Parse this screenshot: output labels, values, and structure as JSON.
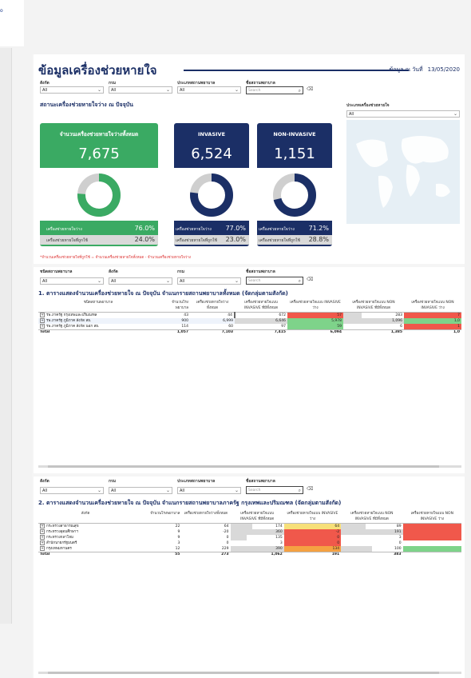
{
  "nav": {
    "fragment": "o"
  },
  "header": {
    "title": "ข้อมูลเครื่องช่วยหายใจ",
    "date_label": "ข้อมูล ณ วันที่",
    "date_value": "13/05/2020"
  },
  "filters_top": {
    "affiliation_label": "สังกัด",
    "ministry_label": "กรม",
    "hosptype_label": "ประเภทสถานพยาบาล",
    "hospname_label": "ชื่อสถานพยาบาล",
    "all": "All",
    "search_placeholder": "Search"
  },
  "status_section": {
    "title": "สถานะเครื่องช่วยหายใจว่าง ณ ปัจจุบัน",
    "machine_type_label": "ประเภทเครื่องช่วยหายใจ",
    "note": "*จำนวนเครื่องช่วยหายใจที่ถูกใช้ = จำนวนเครื่องช่วยหายใจทั้งหมด - จำนวนเครื่องช่วยหายใจว่าง"
  },
  "kpis": [
    {
      "title": "จำนวนเครื่องช่วยหายใจว่างทั้งหมด",
      "value": "7,675",
      "free_label": "เครื่องช่วยหายใจว่าง",
      "free_pct": "76.0%",
      "used_label": "เครื่องช่วยหายใจที่ถูกใช้",
      "used_pct": "24.0%",
      "free_fraction": 0.76,
      "color": "#3aaa63"
    },
    {
      "title": "INVASIVE",
      "value": "6,524",
      "free_label": "เครื่องช่วยหายใจว่าง",
      "free_pct": "77.0%",
      "used_label": "เครื่องช่วยหายใจที่ถูกใช้",
      "used_pct": "23.0%",
      "free_fraction": 0.77,
      "color": "#1b2f66"
    },
    {
      "title": "NON-INVASIVE",
      "value": "1,151",
      "free_label": "เครื่องช่วยหายใจว่าง",
      "free_pct": "71.2%",
      "used_label": "เครื่องช่วยหายใจที่ถูกใช้",
      "used_pct": "28.8%",
      "free_fraction": 0.712,
      "color": "#1b2f66"
    }
  ],
  "table1": {
    "title": "1. ตารางแสดงจำนวนเครื่องช่วยหายใจ ณ ปัจจุบัน จำแนกรายสถานพยาบาลทั้งหมด (จัดกลุ่มตามสังกัด)",
    "filter_labels": {
      "hosptype": "ชนิดสถานพยาบาล",
      "affiliation": "สังกัด",
      "ministry": "กรม",
      "hospname": "ชื่อสถานพยาบาล"
    },
    "headers": [
      "ชนิดสถานพยาบาล",
      "จำนวนโรงพยาบาล",
      "เครื่องช่วยหายใจว่างทั้งหมด",
      "เครื่องช่วยหายใจแบบ INVASIVE ที่มีทั้งหมด",
      "เครื่องช่วยหายใจแบบ INVASIVE ว่าง",
      "เครื่องช่วยหายใจแบบ NON INVASIVE ที่มีทั้งหมด",
      "เครื่องช่วยหายใจแบบ NON INVASIVE ว่าง"
    ],
    "rows": [
      {
        "name": "รพ.ภาครัฐ กรุงเทพและปริมณฑล",
        "c1": "43",
        "c2": "44",
        "c3": "672",
        "c4": "57",
        "c5": "283",
        "c6": "7"
      },
      {
        "name": "รพ.ภาครัฐ ภูมิภาค สังกัด สธ.",
        "c1": "900",
        "c2": "6,999",
        "c3": "6,646",
        "c4": "5,978",
        "c5": "1,096",
        "c6": "1,0"
      },
      {
        "name": "รพ.ภาครัฐ ภูมิภาค สังกัด นอก สธ.",
        "c1": "114",
        "c2": "60",
        "c3": "97",
        "c4": "59",
        "c5": "6",
        "c6": "1"
      }
    ],
    "total": {
      "name": "Total",
      "c1": "1,057",
      "c2": "7,103",
      "c3": "7,415",
      "c4": "6,094",
      "c5": "1,385",
      "c6": "1,0"
    }
  },
  "table2": {
    "title": "2. ตารางแสดงจำนวนเครื่องช่วยหายใจ ณ ปัจจุบัน จำแนกรายสถานพยาบาลภาครัฐ กรุงเทพและปริมณฑล (จัดกลุ่มตามสังกัด)",
    "filter_labels": {
      "affiliation": "สังกัด",
      "ministry": "กรม",
      "hosptype": "ประเภทสถานพยาบาล",
      "hospname": "ชื่อสถานพยาบาล"
    },
    "headers": [
      "สังกัด",
      "จำนวนโรงพยาบาล",
      "เครื่องช่วยหายใจว่างทั้งหมด",
      "เครื่องช่วยหายใจแบบ INVASIVE ที่มีทั้งหมด",
      "เครื่องช่วยหายใจแบบ INVASIVE ว่าง",
      "เครื่องช่วยหายใจแบบ NON INVASIVE ที่มีทั้งหมด",
      "เครื่องช่วยหายใจแบบ NON INVASIVE ว่าง"
    ],
    "rows": [
      {
        "name": "กระทรวงสาธารณสุข",
        "c1": "22",
        "c2": "64",
        "c3": "174",
        "c4": "64",
        "c5": "89",
        "c6": ""
      },
      {
        "name": "กระทรวงอุดมศึกษาฯ",
        "c1": "9",
        "c2": "-20",
        "c3": "360",
        "c4": "-2",
        "c5": "191",
        "c6": ""
      },
      {
        "name": "กระทรวงกลาโหม",
        "c1": "9",
        "c2": "0",
        "c3": "135",
        "c4": "0",
        "c5": "3",
        "c6": ""
      },
      {
        "name": "สำนักนายกรัฐมนตรี",
        "c1": "3",
        "c2": "0",
        "c3": "3",
        "c4": "0",
        "c5": "0",
        "c6": ""
      },
      {
        "name": "กรุงเทพมหานคร",
        "c1": "12",
        "c2": "229",
        "c3": "390",
        "c4": "134",
        "c5": "100",
        "c6": ""
      }
    ],
    "total": {
      "name": "Total",
      "c1": "55",
      "c2": "273",
      "c3": "1,062",
      "c4": "191",
      "c5": "383",
      "c6": ""
    }
  },
  "colors": {
    "green": "#3aaa63",
    "navy": "#1b2f66",
    "red": "#f0584b",
    "orange": "#f5a142",
    "yellow": "#f7e07a",
    "lightgreen": "#7ed38a",
    "grey": "#cfcfcf"
  }
}
